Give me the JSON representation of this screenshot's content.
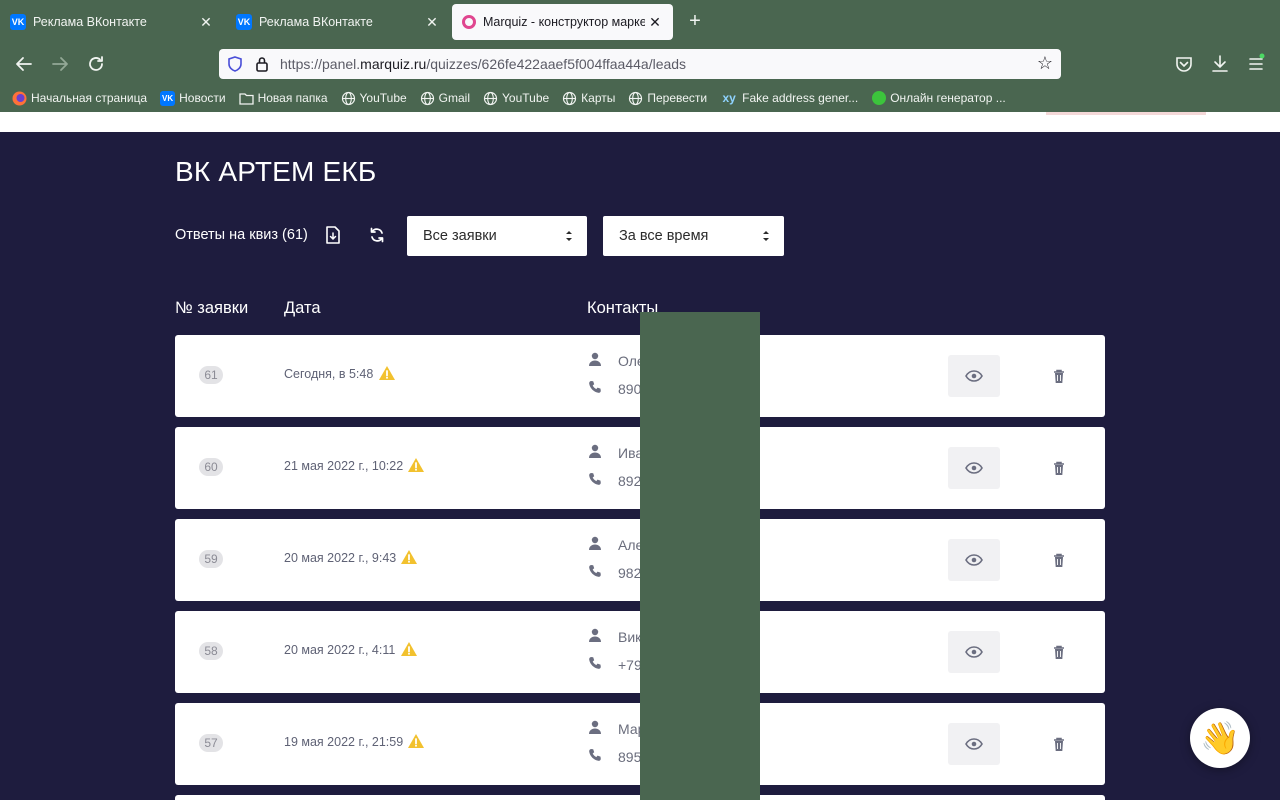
{
  "browser": {
    "tabs": [
      {
        "title": "Реклама ВКонтакте",
        "favicon": "vk-icon",
        "active": false
      },
      {
        "title": "Реклама ВКонтакте",
        "favicon": "vk-icon",
        "active": false
      },
      {
        "title": "Marquiz - конструктор маркети",
        "favicon": "marquiz-icon",
        "active": true
      }
    ],
    "new_tab": "+",
    "url_prefix": "https://panel.",
    "url_domain": "marquiz.ru",
    "url_path": "/quizzes/626fe422aaef5f004ffaa44a/leads",
    "bookmarks": [
      {
        "label": "Начальная страница",
        "icon": "firefox-icon"
      },
      {
        "label": "Новости",
        "icon": "vk-icon"
      },
      {
        "label": "Новая папка",
        "icon": "folder-icon"
      },
      {
        "label": "YouTube",
        "icon": "globe-icon"
      },
      {
        "label": "Gmail",
        "icon": "globe-icon"
      },
      {
        "label": "YouTube",
        "icon": "globe-icon"
      },
      {
        "label": "Карты",
        "icon": "globe-icon"
      },
      {
        "label": "Перевести",
        "icon": "globe-icon"
      },
      {
        "label": "Fake address gener...",
        "icon": "xy-icon"
      },
      {
        "label": "Онлайн генератор ...",
        "icon": "green-dot-icon"
      }
    ]
  },
  "page": {
    "quiz_title": "ВК АРТЕМ ЕКБ",
    "answers_label": "Ответы на квиз (61)",
    "filter_status": "Все заявки",
    "filter_period": "За все время",
    "columns": {
      "number": "№ заявки",
      "date": "Дата",
      "contacts": "Контакты"
    },
    "leads": [
      {
        "number": "61",
        "date": "Сегодня, в 5:48",
        "name": "Оле",
        "phone": "890"
      },
      {
        "number": "60",
        "date": "21 мая 2022 г., 10:22",
        "name": "Ива",
        "phone": "892"
      },
      {
        "number": "59",
        "date": "20 мая 2022 г., 9:43",
        "name": "Але",
        "phone": "982"
      },
      {
        "number": "58",
        "date": "20 мая 2022 г., 4:11",
        "name": "Вик",
        "phone": "+79"
      },
      {
        "number": "57",
        "date": "19 мая 2022 г., 21:59",
        "name": "Мар",
        "phone": "895"
      }
    ],
    "chat_button": "👋"
  },
  "colors": {
    "chrome": "#4a6650",
    "page_bg": "#1e1c3e",
    "warning": "#f2c12e",
    "icon_gray": "#6b6e80"
  }
}
